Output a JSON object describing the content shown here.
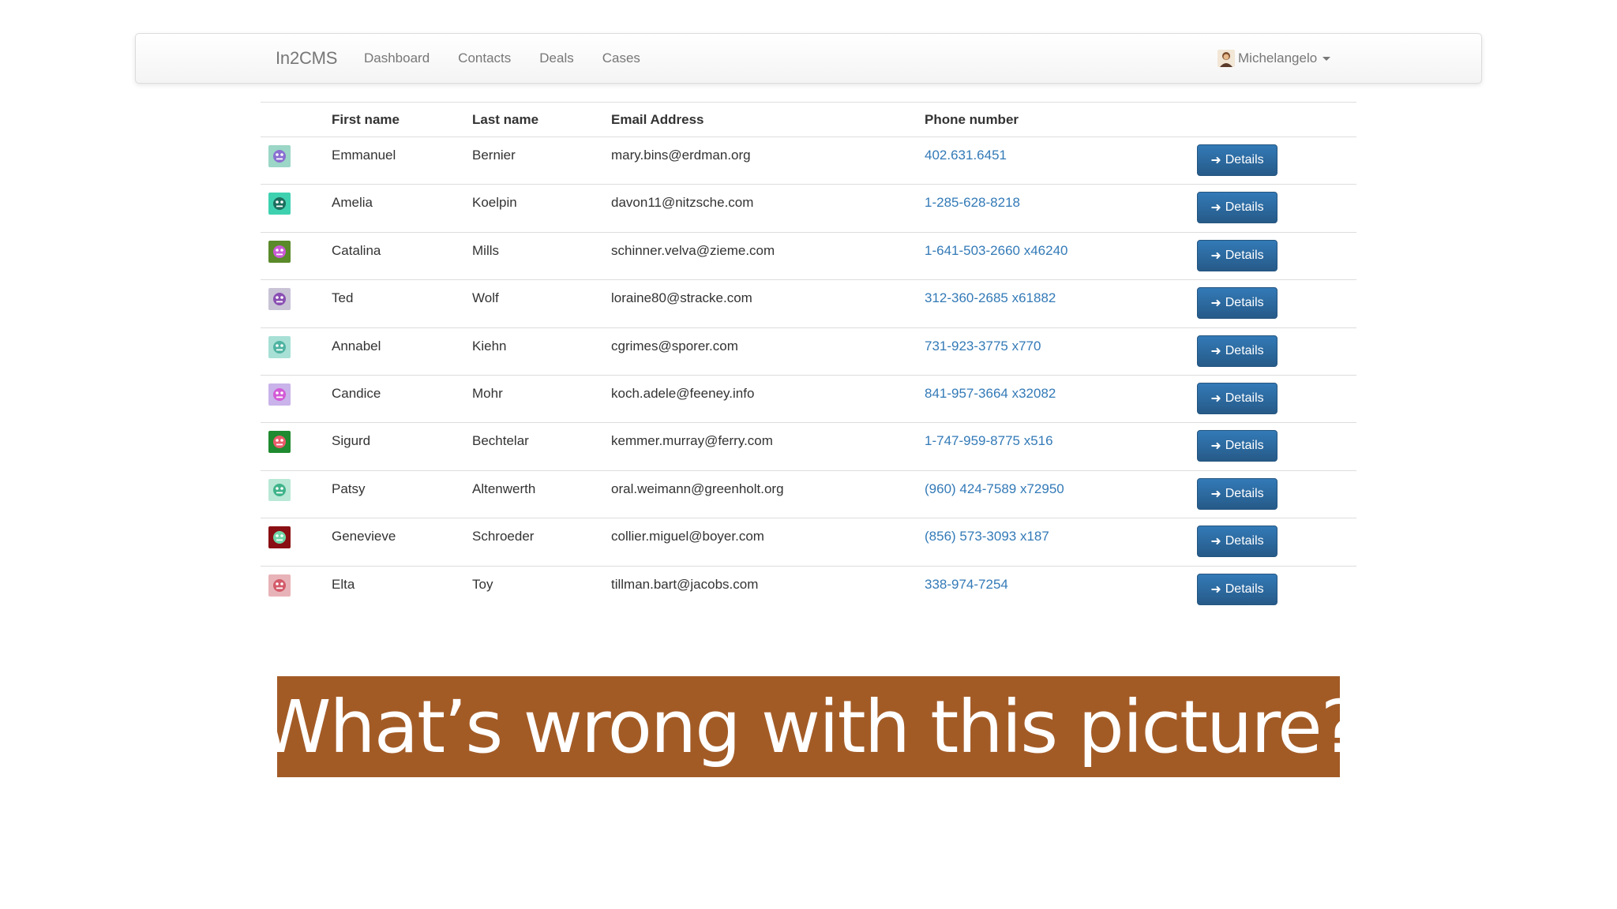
{
  "navbar": {
    "brand": "In2CMS",
    "links": [
      "Dashboard",
      "Contacts",
      "Deals",
      "Cases"
    ],
    "user": {
      "name": "Michelangelo",
      "avatar_icon": "user-portrait-icon"
    }
  },
  "table": {
    "headers": [
      "",
      "First name",
      "Last name",
      "Email Address",
      "Phone number",
      ""
    ],
    "button_label": "Details",
    "button_icon": "arrow-right-icon",
    "rows": [
      {
        "first": "Emmanuel",
        "last": "Bernier",
        "email": "mary.bins@erdman.org",
        "phone": "402.631.6451",
        "avatar_color": "#9bd6c6",
        "avatar_fg": "#8a6fd1"
      },
      {
        "first": "Amelia",
        "last": "Koelpin",
        "email": "davon11@nitzsche.com",
        "phone": "1-285-628-8218",
        "avatar_color": "#3ed1b0",
        "avatar_fg": "#1d6e5e"
      },
      {
        "first": "Catalina",
        "last": "Mills",
        "email": "schinner.velva@zieme.com",
        "phone": "1-641-503-2660 x46240",
        "avatar_color": "#5a8a2a",
        "avatar_fg": "#c95bd6"
      },
      {
        "first": "Ted",
        "last": "Wolf",
        "email": "loraine80@stracke.com",
        "phone": "312-360-2685 x61882",
        "avatar_color": "#c9c3d6",
        "avatar_fg": "#8a4fb3"
      },
      {
        "first": "Annabel",
        "last": "Kiehn",
        "email": "cgrimes@sporer.com",
        "phone": "731-923-3775 x770",
        "avatar_color": "#a8e0d6",
        "avatar_fg": "#4fb3a1"
      },
      {
        "first": "Candice",
        "last": "Mohr",
        "email": "koch.adele@feeney.info",
        "phone": "841-957-3664 x32082",
        "avatar_color": "#c9b3ea",
        "avatar_fg": "#d35bd6"
      },
      {
        "first": "Sigurd",
        "last": "Bechtelar",
        "email": "kemmer.murray@ferry.com",
        "phone": "1-747-959-8775 x516",
        "avatar_color": "#1f8a2f",
        "avatar_fg": "#ea5b6a"
      },
      {
        "first": "Patsy",
        "last": "Altenwerth",
        "email": "oral.weimann@greenholt.org",
        "phone": "(960) 424-7589 x72950",
        "avatar_color": "#b9e8d6",
        "avatar_fg": "#3fb38a"
      },
      {
        "first": "Genevieve",
        "last": "Schroeder",
        "email": "collier.miguel@boyer.com",
        "phone": "(856) 573-3093 x187",
        "avatar_color": "#8a0f14",
        "avatar_fg": "#6fd6a8"
      },
      {
        "first": "Elta",
        "last": "Toy",
        "email": "tillman.bart@jacobs.com",
        "phone": "338-974-7254",
        "avatar_color": "#e8b3b8",
        "avatar_fg": "#d35b6a"
      }
    ]
  },
  "caption": {
    "text": "What’s wrong with this picture?",
    "background": "#a35b26"
  }
}
